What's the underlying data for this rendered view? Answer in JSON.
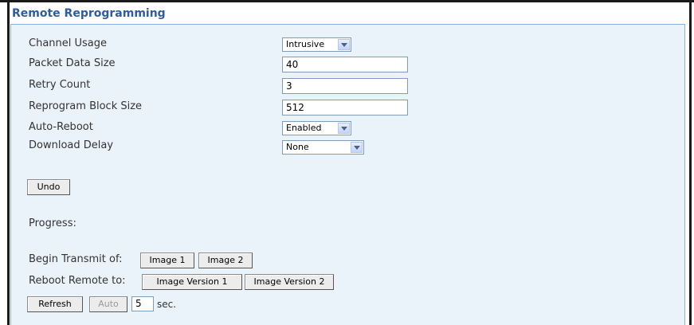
{
  "header": {
    "title": "Remote Reprogramming"
  },
  "form": {
    "channel_usage": {
      "label": "Channel Usage",
      "value": "Intrusive"
    },
    "packet_data_size": {
      "label": "Packet Data Size",
      "value": "40"
    },
    "retry_count": {
      "label": "Retry Count",
      "value": "3"
    },
    "reprogram_block_size": {
      "label": "Reprogram Block Size",
      "value": "512"
    },
    "auto_reboot": {
      "label": "Auto-Reboot",
      "value": "Enabled"
    },
    "download_delay": {
      "label": "Download Delay",
      "value": "None"
    }
  },
  "undo_label": "Undo",
  "progress_label": "Progress:",
  "transmit": {
    "label": "Begin Transmit of:",
    "image1": "Image 1",
    "image2": "Image 2"
  },
  "reboot": {
    "label": "Reboot Remote to:",
    "version1": "Image Version 1",
    "version2": "Image Version 2"
  },
  "refresh": {
    "refresh_label": "Refresh",
    "auto_label": "Auto",
    "interval_value": "5",
    "unit": "sec."
  },
  "colors": {
    "title": "#2f5d9a",
    "panel_bg": "#eaf2fa",
    "panel_border": "#8db0d6"
  }
}
